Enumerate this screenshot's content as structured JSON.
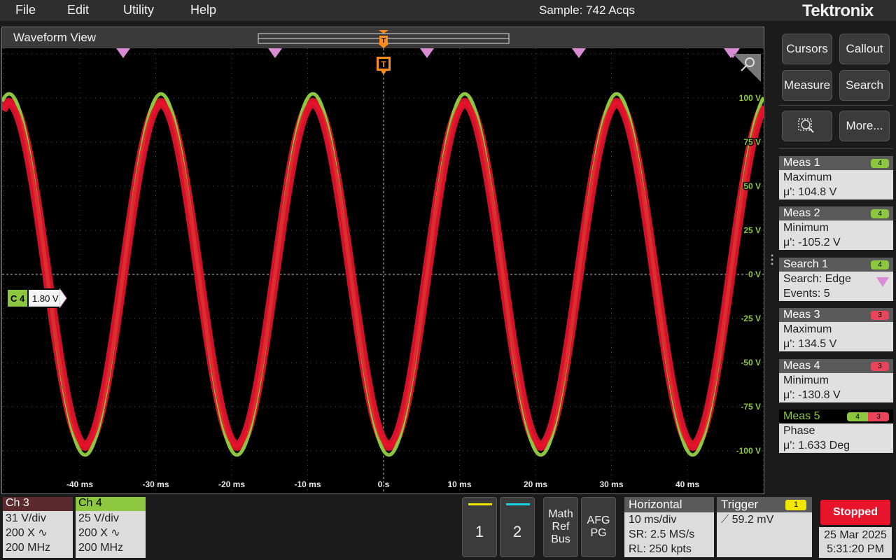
{
  "menu": {
    "items": [
      "File",
      "Edit",
      "Utility",
      "Help"
    ],
    "sample_status": "Sample: 742 Acqs",
    "brand": "Tektronix"
  },
  "waveform_view": {
    "title": "Waveform View",
    "channel_marker": {
      "label": "C 4",
      "value": "1.80 V"
    },
    "trigger_marker": "T",
    "y_tick_labels": [
      "100 V",
      "75 V",
      "50 V",
      "25 V",
      "0 V",
      "-25 V",
      "-50 V",
      "-75 V",
      "-100 V"
    ],
    "x_tick_labels": [
      "-40 ms",
      "-30 ms",
      "-20 ms",
      "-10 ms",
      "0 s",
      "10 ms",
      "20 ms",
      "30 ms",
      "40 ms"
    ],
    "search_event_count": 5
  },
  "right_panel": {
    "buttons": [
      "Cursors",
      "Callout",
      "Measure",
      "Search",
      "More..."
    ],
    "cards": [
      {
        "title": "Meas 1",
        "badge": "4",
        "badge_color": "green",
        "line1": "Maximum",
        "line2": "μ': 104.8 V"
      },
      {
        "title": "Meas 2",
        "badge": "4",
        "badge_color": "green",
        "line1": "Minimum",
        "line2": "μ': -105.2 V"
      },
      {
        "title": "Search 1",
        "badge": "4",
        "badge_color": "green",
        "line1": "Search: Edge",
        "line2": "Events: 5"
      },
      {
        "title": "Meas 3",
        "badge": "3",
        "badge_color": "red",
        "line1": "Maximum",
        "line2": "μ': 134.5 V"
      },
      {
        "title": "Meas 4",
        "badge": "3",
        "badge_color": "red",
        "line1": "Minimum",
        "line2": "μ': -130.8 V"
      },
      {
        "title": "Meas 5",
        "badge": "4",
        "badge2": "3",
        "badge_color": "both",
        "line1": "Phase",
        "line2": "μ': 1.633 Deg"
      }
    ]
  },
  "bottom": {
    "ch3": {
      "title": "Ch 3",
      "scale": "31 V/div",
      "probe": "200 X",
      "bw": "200 MHz"
    },
    "ch4": {
      "title": "Ch 4",
      "scale": "25 V/div",
      "probe": "200 X",
      "bw": "200 MHz"
    },
    "btn1": "1",
    "btn2": "2",
    "math_ref_bus": [
      "Math",
      "Ref",
      "Bus"
    ],
    "afg_pg": [
      "AFG",
      "PG"
    ],
    "horizontal": {
      "title": "Horizontal",
      "scale": "10 ms/div",
      "sr": "SR: 2.5 MS/s",
      "rl": "RL: 250 kpts"
    },
    "trigger": {
      "title": "Trigger",
      "badge": "1",
      "level": "59.2 mV"
    },
    "status": "Stopped",
    "date": "25 Mar 2025",
    "time": "5:31:20 PM"
  },
  "colors": {
    "ch3": "#e8142c",
    "ch4": "#8dc63f",
    "search_marker": "#d98bd3",
    "trigger": "#ff8c1a",
    "ch1_bar": "#f2e600",
    "ch2_bar": "#19d3e0"
  }
}
